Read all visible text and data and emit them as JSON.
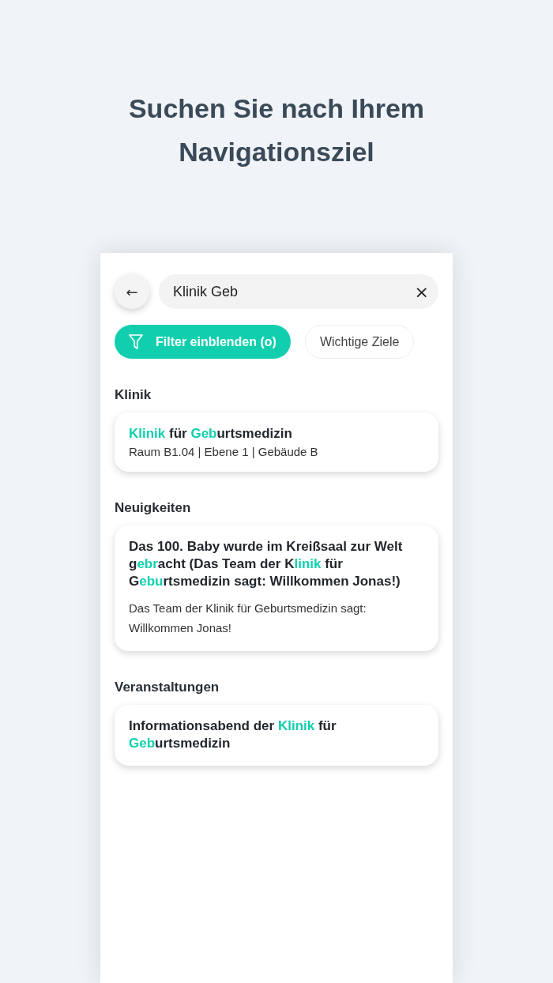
{
  "headline": "Suchen Sie nach Ihrem Navigationsziel",
  "search": {
    "value": "Klinik Geb",
    "back_icon": "←",
    "clear_icon": "×"
  },
  "chips": [
    {
      "kind": "filter",
      "label": "Filter einblenden (o)"
    },
    {
      "kind": "plain",
      "label": "Wichtige Ziele"
    }
  ],
  "sections": [
    {
      "heading": "Klinik",
      "results": [
        {
          "title": [
            {
              "text": "Klinik",
              "highlight": true
            },
            {
              "text": " für ",
              "highlight": false
            },
            {
              "text": "Geb",
              "highlight": true
            },
            {
              "text": "urtsmedizin",
              "highlight": false
            }
          ],
          "subtitle": "Raum B1.04 | Ebene 1 | Gebäude B"
        }
      ]
    },
    {
      "heading": "Neuigkeiten",
      "results": [
        {
          "title": [
            {
              "text": "Das 100. Baby wurde im Kreißsaal zur Welt g",
              "highlight": false
            },
            {
              "text": "ebr",
              "highlight": true
            },
            {
              "text": "acht (Das Team der K",
              "highlight": false
            },
            {
              "text": "linik",
              "highlight": true
            },
            {
              "text": " für G",
              "highlight": false
            },
            {
              "text": "ebu",
              "highlight": true
            },
            {
              "text": "rtsmedizin sagt: Willkommen Jonas!)",
              "highlight": false
            }
          ],
          "body": "Das Team der Klinik für Geburtsmedizin sagt: Willkommen Jonas!"
        }
      ]
    },
    {
      "heading": "Veranstaltungen",
      "results": [
        {
          "title": [
            {
              "text": "Informationsabend der ",
              "highlight": false
            },
            {
              "text": "Klinik",
              "highlight": true
            },
            {
              "text": " für ",
              "highlight": false
            },
            {
              "text": "Geb",
              "highlight": true
            },
            {
              "text": "urtsmedizin",
              "highlight": false
            }
          ]
        }
      ]
    }
  ]
}
